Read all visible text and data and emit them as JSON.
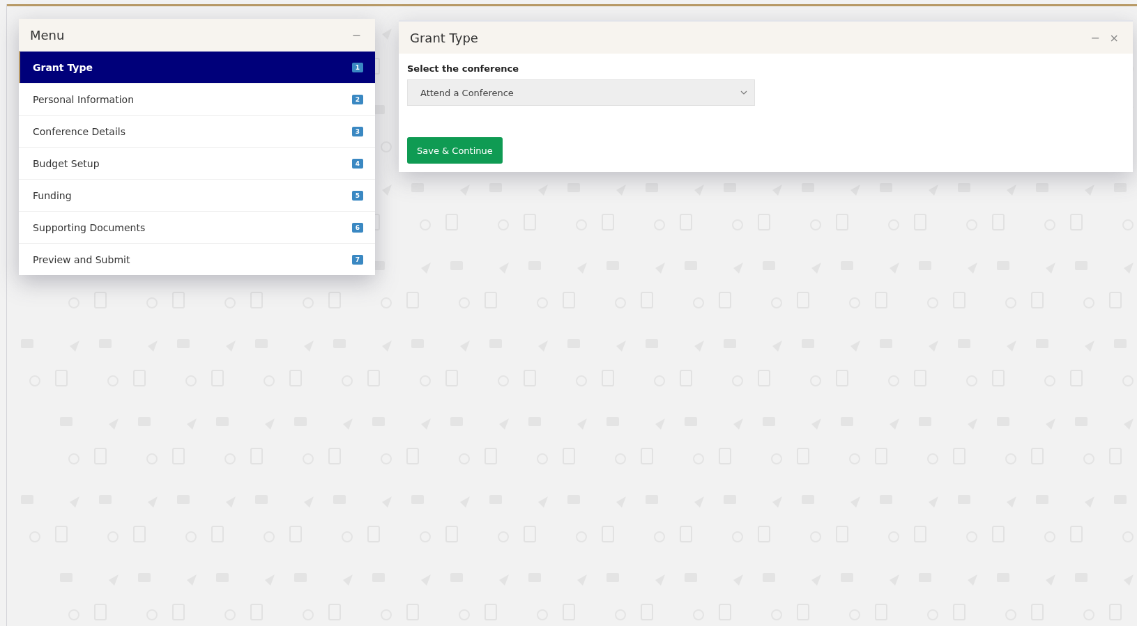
{
  "menu": {
    "title": "Menu",
    "collapse_icon": "−",
    "items": [
      {
        "label": "Grant Type",
        "badge": "1",
        "selected": true
      },
      {
        "label": "Personal Information",
        "badge": "2",
        "selected": false
      },
      {
        "label": "Conference Details",
        "badge": "3",
        "selected": false
      },
      {
        "label": "Budget Setup",
        "badge": "4",
        "selected": false
      },
      {
        "label": "Funding",
        "badge": "5",
        "selected": false
      },
      {
        "label": "Supporting Documents",
        "badge": "6",
        "selected": false
      },
      {
        "label": "Preview and Submit",
        "badge": "7",
        "selected": false
      }
    ]
  },
  "panel": {
    "title": "Grant Type",
    "minimize_icon": "−",
    "close_icon": "×",
    "field_label": "Select the conference",
    "select_value": "Attend a Conference",
    "button": "Save & Continue"
  }
}
